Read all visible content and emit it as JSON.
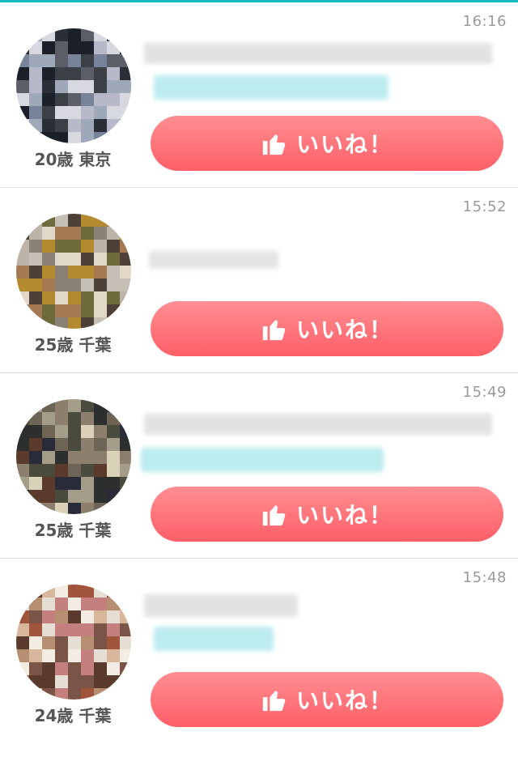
{
  "accent_color": "#18b9c4",
  "button_color": "#ff6a72",
  "posts": [
    {
      "time": "16:16",
      "profile": "20歳 東京",
      "like_label": "いいね！",
      "icon": "thumbs-up-icon",
      "avatar_palette": [
        "#b8b9c8",
        "#9fa8b8",
        "#5b5e66",
        "#2a2e36",
        "#3b3f46",
        "#1b1f29",
        "#78839a",
        "#d7d8e0"
      ]
    },
    {
      "time": "15:52",
      "profile": "25歳 千葉",
      "like_label": "いいね！",
      "icon": "thumbs-up-icon",
      "avatar_palette": [
        "#bdb4a9",
        "#8b8074",
        "#4d4036",
        "#a57a53",
        "#6f6a3c",
        "#b38a2d",
        "#e2d8c7",
        "#c6bfb5"
      ]
    },
    {
      "time": "15:49",
      "profile": "25歳 千葉",
      "like_label": "いいね！",
      "icon": "thumbs-up-icon",
      "avatar_palette": [
        "#6d6455",
        "#4b4b3d",
        "#2c2f2d",
        "#8d7f6d",
        "#2a2b39",
        "#5a3a2b",
        "#d9d2b9",
        "#a39d8a"
      ]
    },
    {
      "time": "15:48",
      "profile": "24歳 千葉",
      "like_label": "いいね！",
      "icon": "thumbs-up-icon",
      "avatar_palette": [
        "#e6ddd3",
        "#b68f72",
        "#7a5547",
        "#c47f7f",
        "#a1543c",
        "#d8b69b",
        "#5a3a2d",
        "#f3ece3"
      ]
    }
  ]
}
